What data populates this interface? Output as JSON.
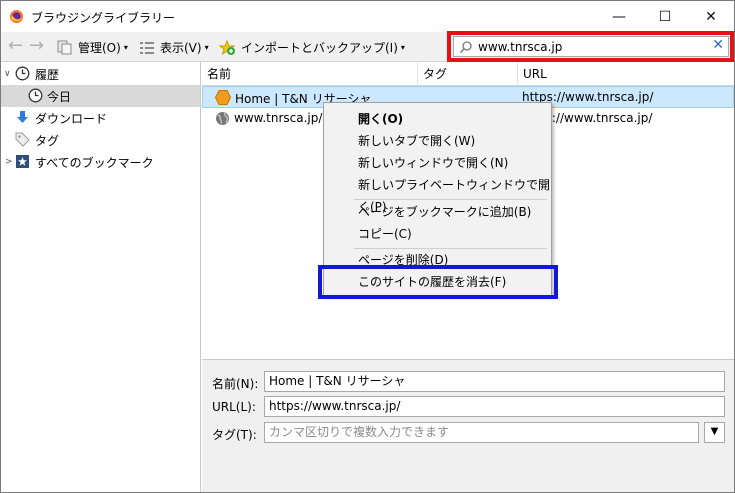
{
  "window": {
    "title": "ブラウジングライブラリー",
    "controls": {
      "minimize": "—",
      "maximize": "☐",
      "close": "✕"
    }
  },
  "toolbar": {
    "back": "←",
    "forward": "→",
    "manage_label": "管理(O)",
    "view_label": "表示(V)",
    "import_label": "インポートとバックアップ(I)",
    "caret": "▾",
    "search": {
      "value": "www.tnrsca.jp",
      "clear": "✕"
    }
  },
  "sidebar": {
    "items": [
      {
        "label": "履歴",
        "icon": "clock-icon",
        "twisty": "∨"
      },
      {
        "label": "今日",
        "icon": "clock-icon"
      },
      {
        "label": "ダウンロード",
        "icon": "download-icon"
      },
      {
        "label": "タグ",
        "icon": "tag-icon"
      },
      {
        "label": "すべてのブックマーク",
        "icon": "bookmark-star-icon",
        "twisty": ">"
      }
    ]
  },
  "list": {
    "columns": [
      "名前",
      "タグ",
      "URL"
    ],
    "rows": [
      {
        "name": "Home | T&N リサーシャ",
        "tags": "",
        "url": "https://www.tnrsca.jp/",
        "icon": "site-favicon"
      },
      {
        "name": "www.tnrsca.jp/",
        "tags": "",
        "url": "https://www.tnrsca.jp/",
        "icon": "globe-icon"
      }
    ]
  },
  "context_menu": {
    "items": [
      "開く(O)",
      "新しいタブで開く(W)",
      "新しいウィンドウで開く(N)",
      "新しいプライベートウィンドウで開く(P)",
      "ページをブックマークに追加(B)",
      "コピー(C)",
      "ページを削除(D)",
      "このサイトの履歴を消去(F)"
    ]
  },
  "details": {
    "name_label": "名前(N):",
    "name_value": "Home | T&N リサーシャ",
    "url_label": "URL(L):",
    "url_value": "https://www.tnrsca.jp/",
    "tag_label": "タグ(T):",
    "tag_placeholder": "カンマ区切りで複数入力できます",
    "dropdown": "▼"
  },
  "colors": {
    "highlight_red": "#e0121a",
    "highlight_blue": "#1218d6",
    "selection": "#cce8ff"
  }
}
